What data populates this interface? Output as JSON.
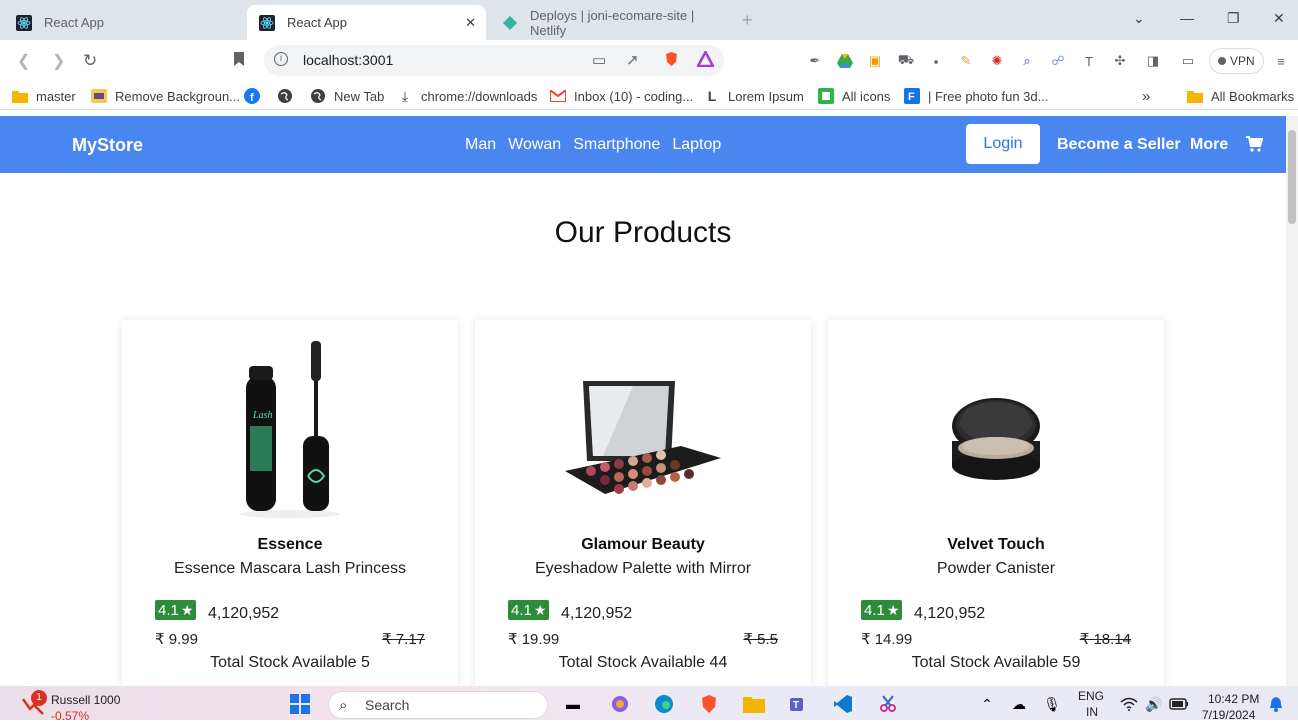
{
  "browser": {
    "tabs": [
      {
        "title": "React App",
        "active": false
      },
      {
        "title": "React App",
        "active": true
      },
      {
        "title": "Deploys | joni-ecomare-site | Netlify",
        "active": false
      }
    ],
    "url": "localhost:3001",
    "vpn_label": "VPN",
    "bookmarks": [
      "master",
      "Remove Backgroun...",
      "",
      "",
      "New Tab",
      "chrome://downloads",
      "Inbox (10) - coding...",
      "Lorem Ipsum",
      "All icons",
      "| Free photo fun 3d...",
      "All Bookmarks"
    ],
    "bookmarks_overflow": "»"
  },
  "store": {
    "brand": "MyStore",
    "nav_links": [
      "Man",
      "Wowan",
      "Smartphone",
      "Laptop"
    ],
    "login_label": "Login",
    "seller_label": "Become a Seller",
    "more_label": "More",
    "heading": "Our Products",
    "products": [
      {
        "brand": "Essence",
        "title": "Essence Mascara Lash Princess",
        "rating": "4.1",
        "reviews": "4,120,952",
        "price": "₹ 9.99",
        "old_price": "₹ 7.17",
        "stock": "Total Stock Available 5"
      },
      {
        "brand": "Glamour Beauty",
        "title": "Eyeshadow Palette with Mirror",
        "rating": "4.1",
        "reviews": "4,120,952",
        "price": "₹ 19.99",
        "old_price": "₹ 5.5",
        "stock": "Total Stock Available 44"
      },
      {
        "brand": "Velvet Touch",
        "title": "Powder Canister",
        "rating": "4.1",
        "reviews": "4,120,952",
        "price": "₹ 14.99",
        "old_price": "₹ 18.14",
        "stock": "Total Stock Available 59"
      }
    ]
  },
  "taskbar": {
    "stock_name": "Russell 1000",
    "stock_change": "-0.57%",
    "notification_count": "1",
    "search_placeholder": "Search",
    "lang_line1": "ENG",
    "lang_line2": "IN",
    "time": "10:42 PM",
    "date": "7/19/2024"
  },
  "colors": {
    "navbar": "#4a86ef",
    "rating_badge": "#2e8b3a",
    "login_text": "#2874f0"
  }
}
